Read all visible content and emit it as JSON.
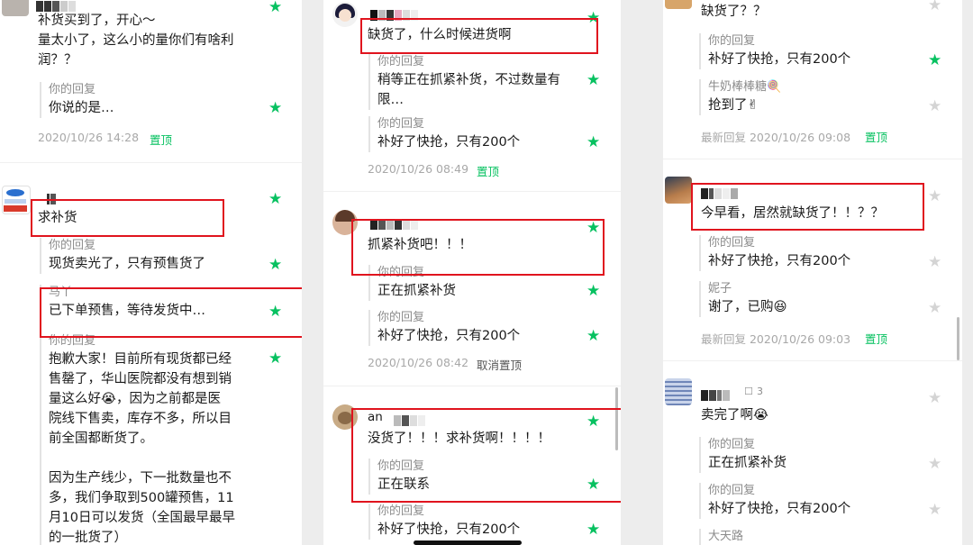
{
  "panel1": {
    "c1_text": "补货买到了，开心～\n量太小了，这么小的量你们有啥利\n润？？",
    "c1_reply_who": "你的回复",
    "c1_reply_body": "你说的是…",
    "c1_time": "2020/10/26 14:28",
    "c1_pin": "置顶",
    "c2_text": "求补货",
    "c2_reply1_who": "你的回复",
    "c2_reply1_body": "现货卖光了，只有预售货了",
    "c2_reply2_who": "马丫",
    "c2_reply2_body": "已下单预售，等待发货中…",
    "c2_reply3_who": "你的回复",
    "c2_reply3_body": "抱歉大家！目前所有现货都已经\n售罄了，华山医院都没有想到销\n量这么好😭，因为之前都是医\n院线下售卖，库存不多，所以目\n前全国都断货了。\n\n因为生产线少，下一批数量也不\n多，我们争取到500罐预售，11\n月10日可以发货（全国最早最早\n的一批货了）"
  },
  "panel2": {
    "c1_text": "缺货了，什么时候进货啊",
    "c1_reply1_who": "你的回复",
    "c1_reply1_body": "稍等正在抓紧补货，不过数量有\n限…",
    "c1_reply2_who": "你的回复",
    "c1_reply2_body": "补好了快抢，只有200个",
    "c1_time": "2020/10/26 08:49",
    "c1_pin": "置顶",
    "c2_text": "抓紧补货吧！！！",
    "c2_reply1_who": "你的回复",
    "c2_reply1_body": "正在抓紧补货",
    "c2_reply2_who": "你的回复",
    "c2_reply2_body": "补好了快抢，只有200个",
    "c2_time": "2020/10/26 08:42",
    "c2_unpin": "取消置顶",
    "c3_name": "an",
    "c3_text": "没货了！！！求补货啊！！！！",
    "c3_reply1_who": "你的回复",
    "c3_reply1_body": "正在联系",
    "c3_reply2_who": "你的回复",
    "c3_reply2_body": "补好了快抢，只有200个"
  },
  "panel3": {
    "c1_text": "缺货了？？",
    "c1_reply1_who": "你的回复",
    "c1_reply1_body": "补好了快抢，只有200个",
    "c1_reply2_who": "牛奶棒棒糖🍭",
    "c1_reply2_body": "抢到了✌",
    "c1_time": "最新回复 2020/10/26 09:08",
    "c1_pin": "置顶",
    "c2_text": "今早看，居然就缺货了！！？？",
    "c2_reply1_who": "你的回复",
    "c2_reply1_body": "补好了快抢，只有200个",
    "c2_reply2_who": "妮子",
    "c2_reply2_body": "谢了，已购😆",
    "c2_time": "最新回复 2020/10/26 09:03",
    "c2_pin": "置顶",
    "c3_likes": "3",
    "c3_text": "卖完了啊😭",
    "c3_reply1_who": "你的回复",
    "c3_reply1_body": "正在抓紧补货",
    "c3_reply2_who": "你的回复",
    "c3_reply2_body": "补好了快抢，只有200个",
    "c3_reply3_who": "大天路"
  },
  "icons": {
    "star": "★"
  },
  "colors": {
    "accent": "#07c160",
    "highlight": "#e0141e"
  }
}
